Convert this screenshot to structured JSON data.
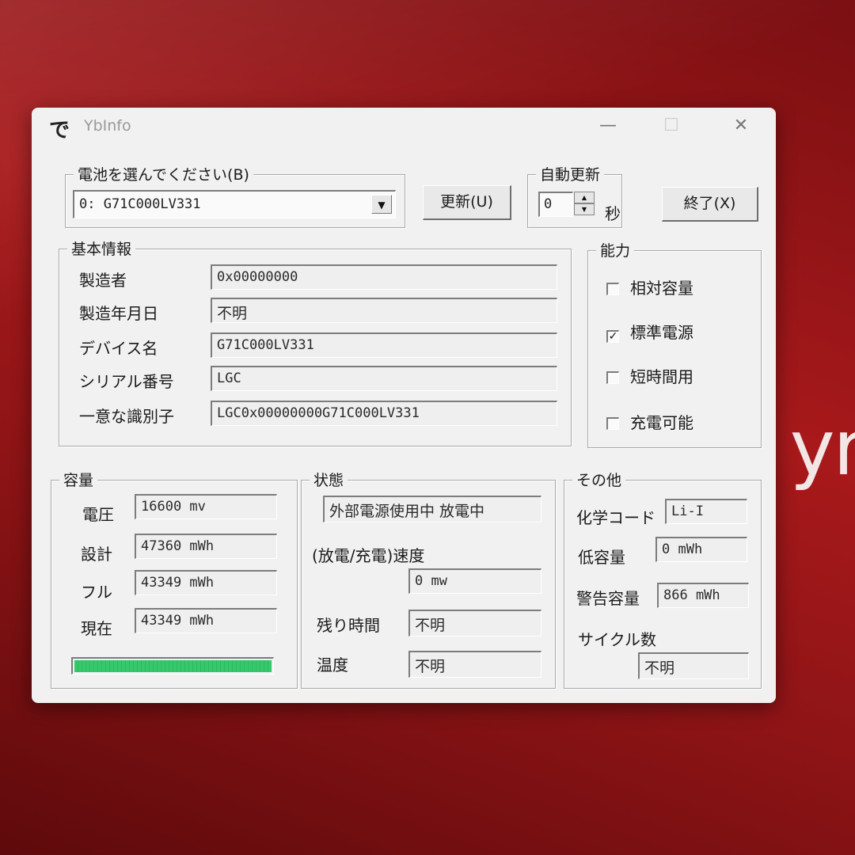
{
  "background": {
    "partial_text": "yr"
  },
  "window": {
    "icon_glyph": "で",
    "title": "YbInfo"
  },
  "battery_select": {
    "legend": "電池を選んでください(B)",
    "selected": "0: G71C000LV331"
  },
  "buttons": {
    "update": "更新(U)",
    "exit": "終了(X)"
  },
  "auto_update": {
    "legend": "自動更新",
    "value": "0",
    "unit": "秒"
  },
  "basic_info": {
    "legend": "基本情報",
    "rows": [
      {
        "label": "製造者",
        "value": "0x00000000"
      },
      {
        "label": "製造年月日",
        "value": "不明"
      },
      {
        "label": "デバイス名",
        "value": "G71C000LV331"
      },
      {
        "label": "シリアル番号",
        "value": "LGC"
      },
      {
        "label": "一意な識別子",
        "value": "LGC0x00000000G71C000LV331"
      }
    ]
  },
  "capability": {
    "legend": "能力",
    "items": [
      {
        "label": "相対容量",
        "checked": false
      },
      {
        "label": "標準電源",
        "checked": true
      },
      {
        "label": "短時間用",
        "checked": false
      },
      {
        "label": "充電可能",
        "checked": false
      }
    ]
  },
  "capacity": {
    "legend": "容量",
    "rows": [
      {
        "label": "電圧",
        "value": "16600 mv"
      },
      {
        "label": "設計",
        "value": "47360 mWh"
      },
      {
        "label": "フル",
        "value": "43349 mWh"
      },
      {
        "label": "現在",
        "value": "43349 mWh"
      }
    ],
    "charge_fraction": 1.0
  },
  "status": {
    "legend": "状態",
    "state": "外部電源使用中 放電中",
    "rate_label": "(放電/充電)速度",
    "rate_value": "0 mw",
    "remaining_label": "残り時間",
    "remaining_value": "不明",
    "temp_label": "温度",
    "temp_value": "不明"
  },
  "other": {
    "legend": "その他",
    "chem_label": "化学コード",
    "chem_value": "Li-I",
    "low_label": "低容量",
    "low_value": "0 mWh",
    "warn_label": "警告容量",
    "warn_value": "866 mWh",
    "cycle_label": "サイクル数",
    "cycle_value": "不明"
  }
}
